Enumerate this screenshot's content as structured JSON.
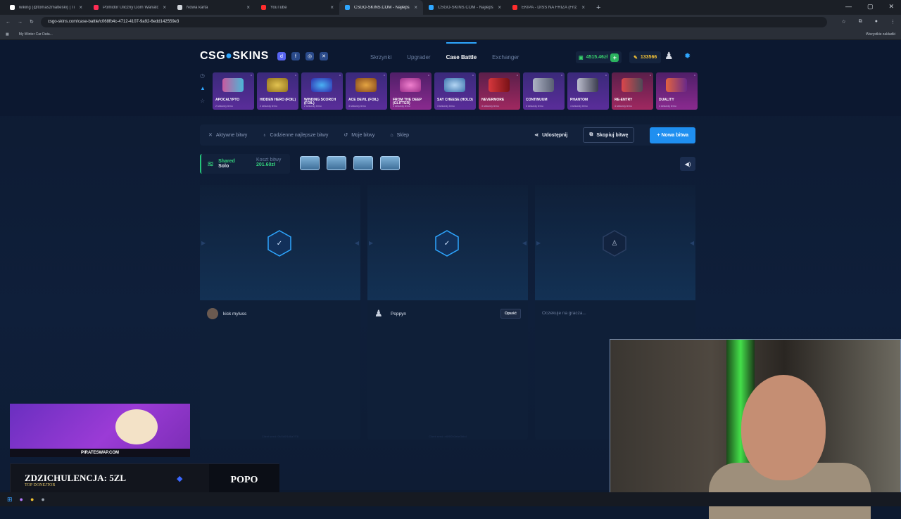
{
  "browser": {
    "tabs": [
      {
        "title": "wiking (@tomaszmatleski) | Tik",
        "color": "#ffffff"
      },
      {
        "title": "Pomidor Uliczny Dom Wariatów",
        "color": "#ff2d55"
      },
      {
        "title": "Nowa karta",
        "color": "#cfd4da"
      },
      {
        "title": "YouTube",
        "color": "#ff2d2d"
      },
      {
        "title": "CSGO-SKINS.COM - Najlepsze",
        "color": "#2ea6ff",
        "active": true
      },
      {
        "title": "CSGO-SKINS.COM - Najlepsze",
        "color": "#2ea6ff"
      },
      {
        "title": "EKIPA - DISS NA FRIZA (Friz, Ka",
        "color": "#ff2d2d"
      }
    ],
    "url": "csgo-skins.com/case-battle/c068fb4c-4712-4107-9a92-6edd142559e3",
    "bookmark": "My Winter Car Data...",
    "bookmarks_right": "Wszystkie zakładki"
  },
  "site": {
    "logo_left": "CSG",
    "logo_mid": "●",
    "logo_right": "SKINS",
    "nav": [
      "Skrzynki",
      "Upgrader",
      "Case Battle",
      "Exchanger"
    ],
    "balance": "4515.46zł",
    "points": "133566"
  },
  "drops": [
    {
      "name": "APOCALYPTO",
      "time": "2 sekundy temu"
    },
    {
      "name": "HIDDEN HERO (FOIL)",
      "time": "2 sekundy temu"
    },
    {
      "name": "WINDING SCORCH (FOIL)",
      "time": "2 sekundy temu"
    },
    {
      "name": "ACE DEVIL (FOIL)",
      "time": "3 sekundy temu"
    },
    {
      "name": "FROM THE DEEP (GLITTER)",
      "time": "3 sekundy temu"
    },
    {
      "name": "SAY CHEESE (HOLO)",
      "time": "3 sekundy temu"
    },
    {
      "name": "NEVERMORE",
      "time": "3 sekundy temu"
    },
    {
      "name": "CONTINUUM",
      "time": "3 sekundy temu"
    },
    {
      "name": "PHANTOM",
      "time": "4 sekundy temu"
    },
    {
      "name": "RE-ENTRY",
      "time": "4 sekundy temu"
    },
    {
      "name": "DUALITY",
      "time": "4 sekundy temu"
    }
  ],
  "toolbar": {
    "active": "Aktywne bitwy",
    "daily": "Codzienne najlepsze bitwy",
    "mine": "Moje bitwy",
    "shop": "Sklep",
    "share": "Udostępnij",
    "copy": "Skopiuj bitwę",
    "new": "+ Nowa bitwa"
  },
  "battle": {
    "mode_top": "Shared",
    "mode_bottom": "Solo",
    "cost_label": "Koszt bitwy",
    "cost_value": "201.60zł"
  },
  "slots": [
    {
      "player": "kick myluss",
      "status": "ready",
      "seed": "Client seed: 0fc5d0f1d6a7f78"
    },
    {
      "player": "Poppyn",
      "status": "ready",
      "leave": "Opuść",
      "seed": "Client seed: e8f9f2b3ebe3bbd"
    },
    {
      "player": "",
      "status": "waiting",
      "wait": "Oczekuje na gracza..."
    }
  ],
  "stream": {
    "ad": "PIRATESWAP.COM",
    "donor_msg": "ZDZICHULENCJA: 5ZL",
    "donor_sub": "TOP DONEJTOR",
    "donor_name": "POPO"
  }
}
